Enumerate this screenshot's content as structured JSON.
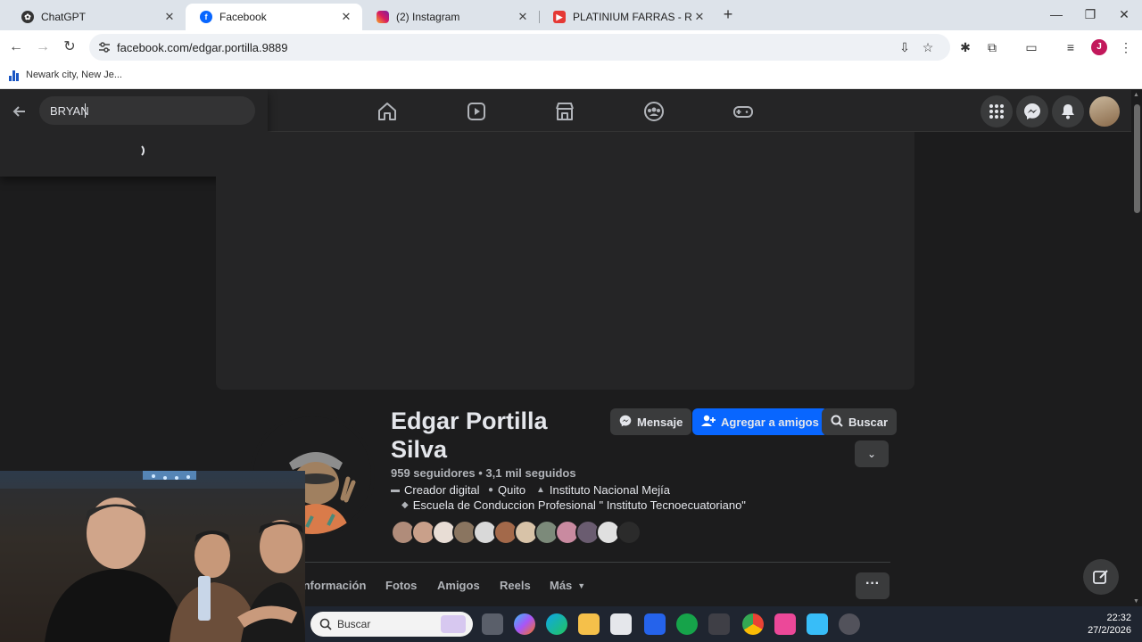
{
  "browser": {
    "tabs": [
      {
        "title": "ChatGPT",
        "icon": "chatgpt-icon",
        "active": false
      },
      {
        "title": "Facebook",
        "icon": "facebook-icon",
        "active": true
      },
      {
        "title": "(2) Instagram",
        "icon": "instagram-icon",
        "active": false
      },
      {
        "title": "PLATINIUM FARRAS - RAKATA",
        "icon": "youtube-icon",
        "active": false
      }
    ],
    "url": "facebook.com/edgar.portilla.9889",
    "profile_initial": "J",
    "bookmark": "Newark city, New Je..."
  },
  "facebook": {
    "search_value": "BRYAN",
    "profile": {
      "name": "Edgar Portilla Silva",
      "stats": "959 seguidores • 3,1 mil seguidos",
      "role": "Creador digital",
      "city": "Quito",
      "school1": "Instituto Nacional Mejía",
      "school2": "Escuela de Conduccion Profesional \" Instituto Tecnoecuatoriano\""
    },
    "buttons": {
      "message": "Mensaje",
      "add_friend": "Agregar a amigos",
      "search": "Buscar"
    },
    "tabs": [
      "Información",
      "Fotos",
      "Amigos",
      "Reels",
      "Más"
    ],
    "colors": {
      "primary": "#0866ff",
      "bg": "#1c1c1d",
      "surface": "#252526"
    }
  },
  "taskbar": {
    "search_placeholder": "Buscar",
    "time": "22:32",
    "date": "27/2/2026"
  }
}
